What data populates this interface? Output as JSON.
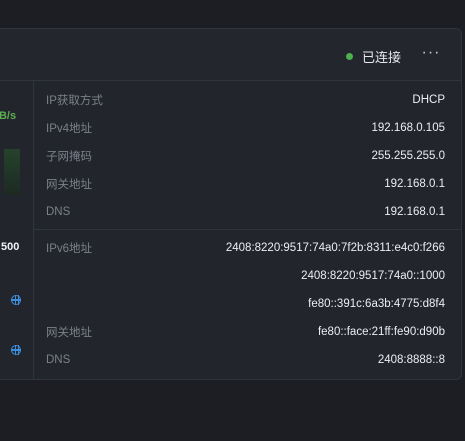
{
  "header": {
    "status_text": "已连接",
    "more_icon": "more-horizontal-icon"
  },
  "left_panel": {
    "speed_unit": "KB/s",
    "count_text": "500",
    "icons": [
      "globe-icon",
      "globe-icon"
    ]
  },
  "ipv4": [
    {
      "label": "IP获取方式",
      "value": "DHCP"
    },
    {
      "label": "IPv4地址",
      "value": "192.168.0.105"
    },
    {
      "label": "子网掩码",
      "value": "255.255.255.0"
    },
    {
      "label": "网关地址",
      "value": "192.168.0.1"
    },
    {
      "label": "DNS",
      "value": "192.168.0.1"
    }
  ],
  "ipv6": {
    "address_label": "IPv6地址",
    "addresses": [
      "2408:8220:9517:74a0:7f2b:8311:e4c0:f266",
      "2408:8220:9517:74a0::1000",
      "fe80::391c:6a3b:4775:d8f4"
    ],
    "gateway_label": "网关地址",
    "gateway_value": "fe80::face:21ff:fe90:d90b",
    "dns_label": "DNS",
    "dns_value": "2408:8888::8"
  },
  "colors": {
    "background": "#1c1e24",
    "card": "#22252c",
    "status_connected": "#4bb04f",
    "speed_accent": "#5fae52",
    "globe_icon": "#3d8edc"
  }
}
